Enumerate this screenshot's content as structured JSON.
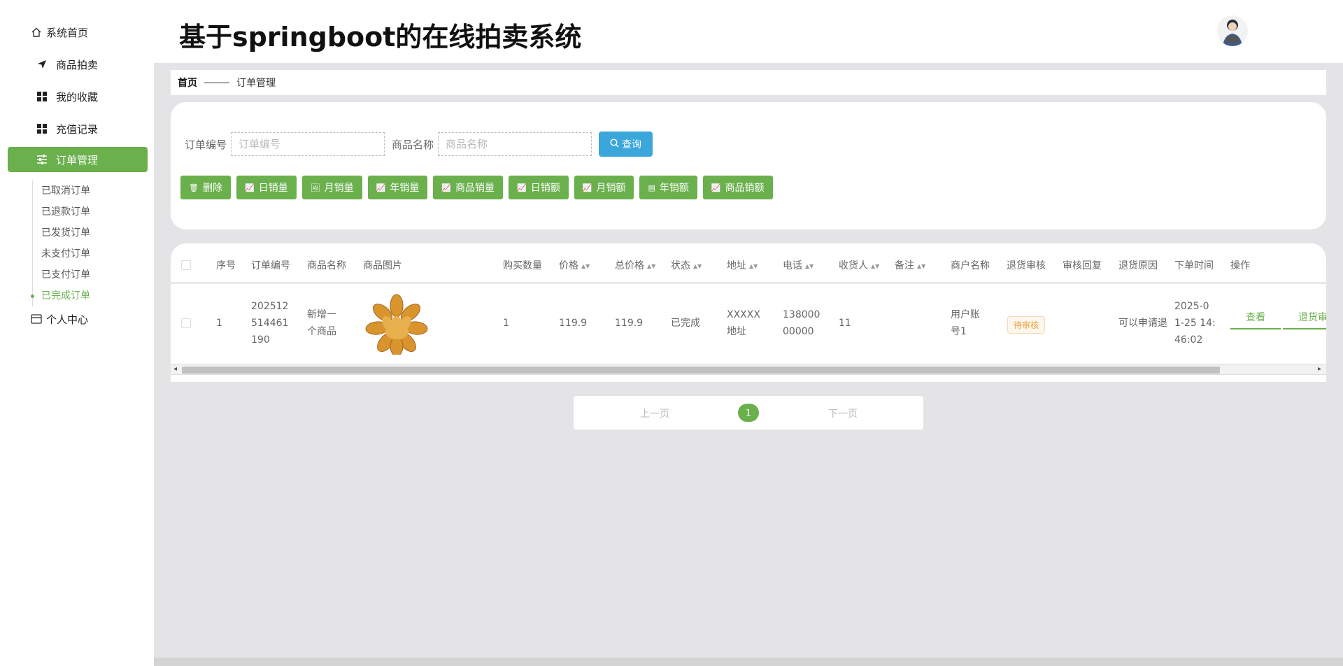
{
  "app": {
    "title": "基于springboot的在线拍卖系统"
  },
  "sidebar": {
    "items": [
      {
        "label": "系统首页",
        "icon": "home-icon"
      },
      {
        "label": "商品拍卖",
        "icon": "send-icon"
      },
      {
        "label": "我的收藏",
        "icon": "grid-icon"
      },
      {
        "label": "充值记录",
        "icon": "grid-icon"
      },
      {
        "label": "订单管理",
        "icon": "sliders-icon"
      },
      {
        "label": "个人中心",
        "icon": "card-icon"
      }
    ],
    "submenu": [
      {
        "label": "已取消订单"
      },
      {
        "label": "已退款订单"
      },
      {
        "label": "已发货订单"
      },
      {
        "label": "未支付订单"
      },
      {
        "label": "已支付订单"
      },
      {
        "label": "已完成订单"
      }
    ],
    "active_submenu": "已完成订单"
  },
  "breadcrumb": {
    "home": "首页",
    "current": "订单管理"
  },
  "search": {
    "order_no_label": "订单编号",
    "order_no_placeholder": "订单编号",
    "goods_name_label": "商品名称",
    "goods_name_placeholder": "商品名称",
    "query_label": "查询"
  },
  "actions": [
    {
      "label": "删除",
      "icon": "trash-icon"
    },
    {
      "label": "日销量",
      "icon": "chart-icon"
    },
    {
      "label": "月销量",
      "icon": "image-icon"
    },
    {
      "label": "年销量",
      "icon": "chart-icon"
    },
    {
      "label": "商品销量",
      "icon": "chart-icon"
    },
    {
      "label": "日销额",
      "icon": "chart-icon"
    },
    {
      "label": "月销额",
      "icon": "chart-icon"
    },
    {
      "label": "年销额",
      "icon": "table-icon"
    },
    {
      "label": "商品销额",
      "icon": "chart-icon"
    }
  ],
  "table": {
    "headers": [
      "序号",
      "订单编号",
      "商品名称",
      "商品图片",
      "购买数量",
      "价格",
      "总价格",
      "状态",
      "地址",
      "电话",
      "收货人",
      "备注",
      "商户名称",
      "退货审核",
      "审核回复",
      "退货原因",
      "下单时间",
      "操作"
    ],
    "rows": [
      {
        "index": "1",
        "order_no": [
          "202512",
          "514461",
          "190"
        ],
        "goods_name": [
          "新增一",
          "个商品"
        ],
        "quantity": "1",
        "price": "119.9",
        "total": "119.9",
        "status": "已完成",
        "address": [
          "XXXXX",
          "地址"
        ],
        "phone": [
          "138000",
          "00000"
        ],
        "receiver": "11",
        "merchant": [
          "用户账",
          "号1"
        ],
        "return_review": "待审核",
        "return_reason": "可以申请退",
        "order_time": [
          "2025-0",
          "1-25 14:",
          "46:02"
        ],
        "ops": [
          "查看",
          "退货审"
        ]
      }
    ]
  },
  "pagination": {
    "prev": "上一页",
    "current": "1",
    "next": "下一页"
  },
  "colors": {
    "accent": "#6ab04c",
    "query": "#3ba6da",
    "badge": "#e6a23c"
  }
}
